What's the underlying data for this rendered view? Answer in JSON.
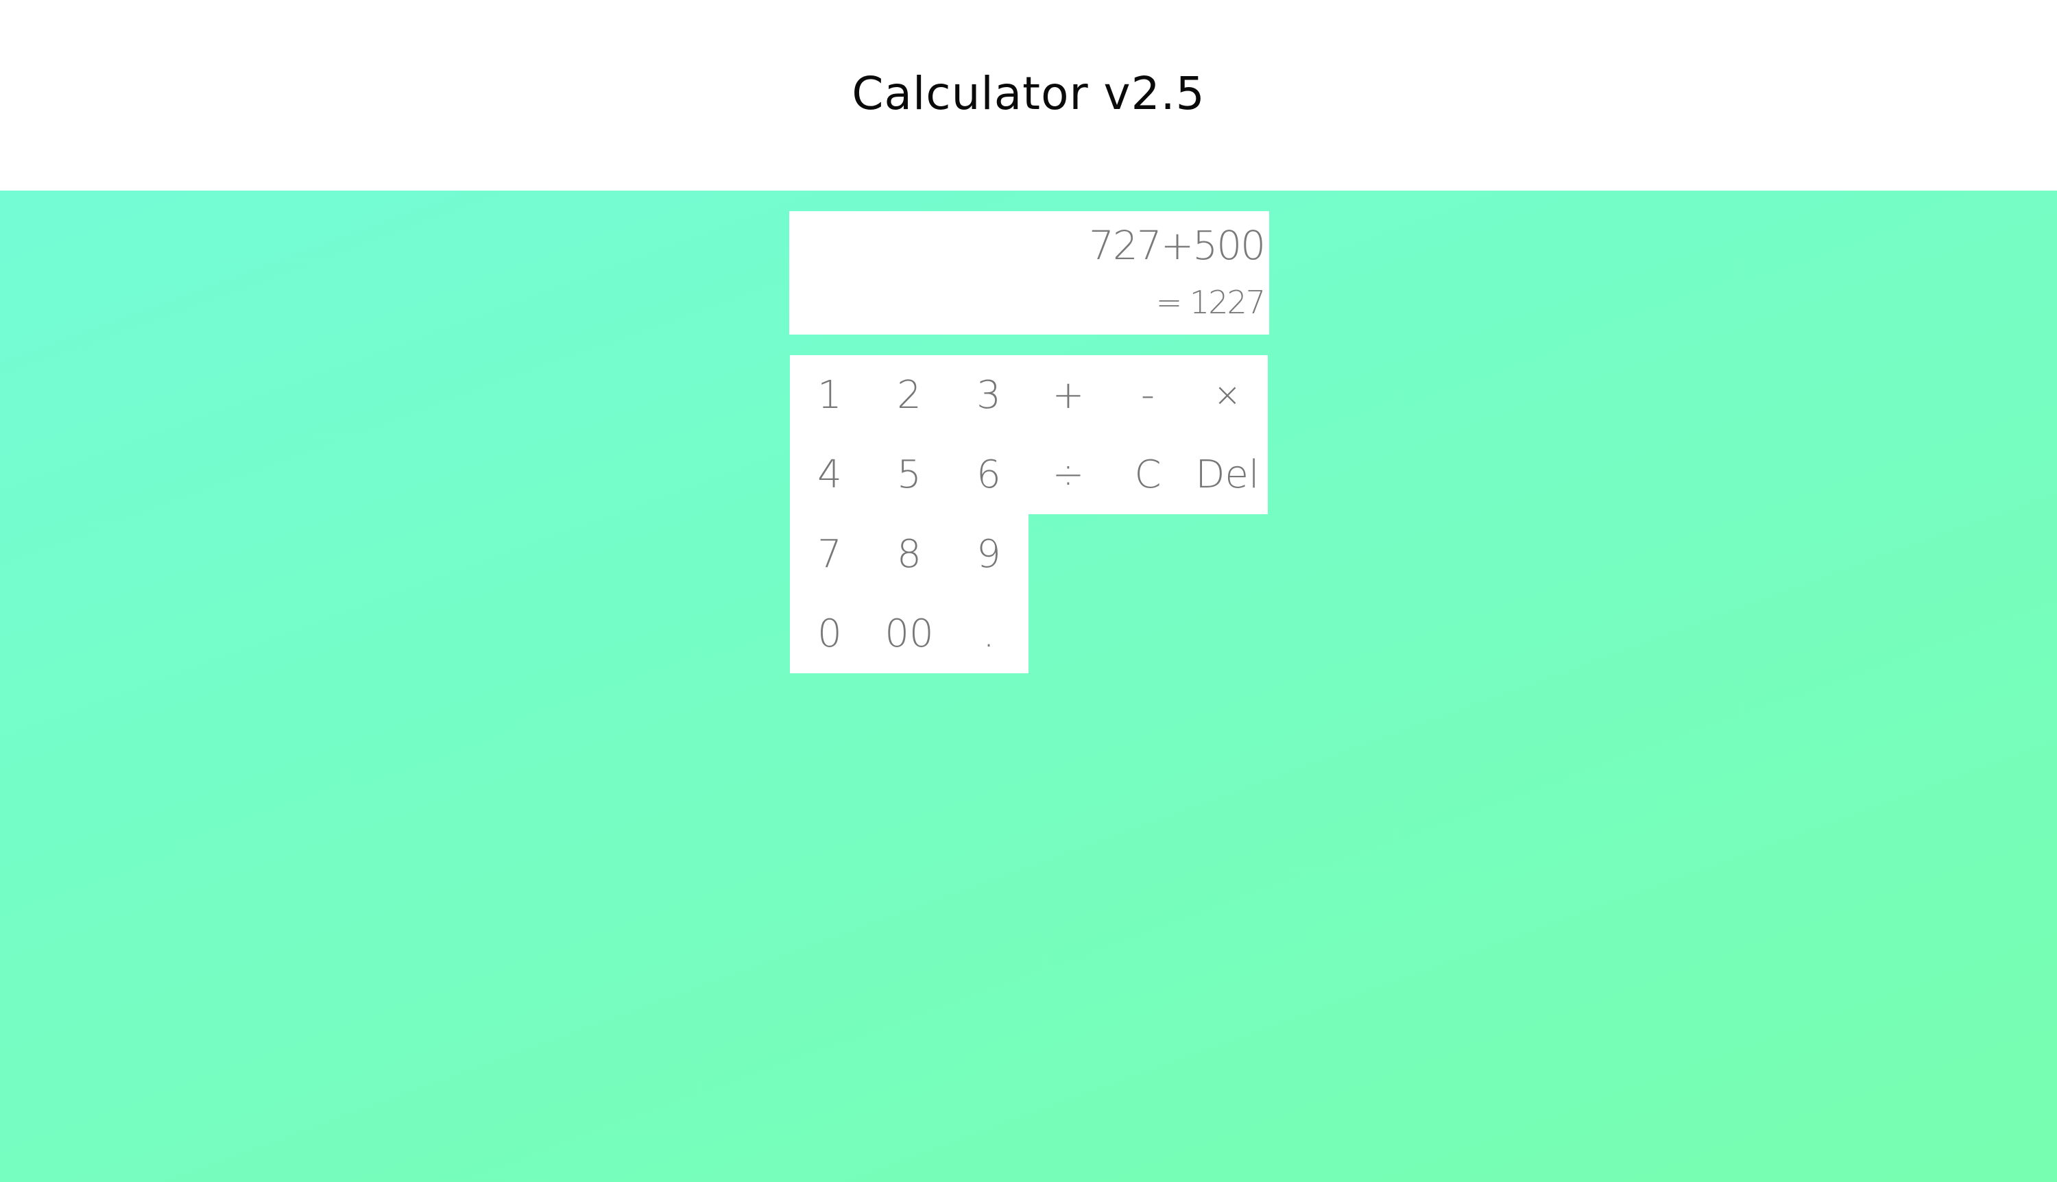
{
  "header": {
    "title": "Calculator v2.5"
  },
  "display": {
    "expression": "727+500",
    "result": "= 1227"
  },
  "keypad": {
    "k1": "1",
    "k2": "2",
    "k3": "3",
    "plus": "+",
    "minus": "-",
    "times": "×",
    "k4": "4",
    "k5": "5",
    "k6": "6",
    "divide": "÷",
    "clear": "C",
    "delete": "Del",
    "k7": "7",
    "k8": "8",
    "k9": "9",
    "k0": "0",
    "k00": "00",
    "dot": "."
  },
  "colors": {
    "background_start": "#74fcd9",
    "background_end": "#77feb0",
    "panel": "#ffffff",
    "key_text": "#777777",
    "title_text": "#0a0a0a"
  }
}
